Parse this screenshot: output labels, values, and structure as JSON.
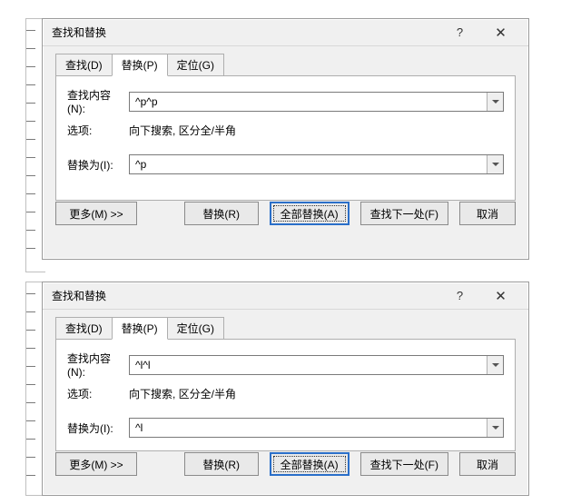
{
  "dialog": {
    "title": "查找和替换",
    "help_label": "?",
    "close_label": "✕"
  },
  "tabs": {
    "find": "查找(D)",
    "replace": "替换(P)",
    "goto": "定位(G)"
  },
  "labels": {
    "find_what": "查找内容(N):",
    "options": "选项:",
    "options_value": "向下搜索, 区分全/半角",
    "replace_with": "替换为(I):"
  },
  "buttons": {
    "more": "更多(M) >>",
    "replace": "替换(R)",
    "replace_all": "全部替换(A)",
    "find_next": "查找下一处(F)",
    "cancel": "取消"
  },
  "top": {
    "find_value": "^p^p",
    "replace_value": "^p"
  },
  "bottom": {
    "find_value": "^l^l",
    "replace_value": "^l"
  }
}
